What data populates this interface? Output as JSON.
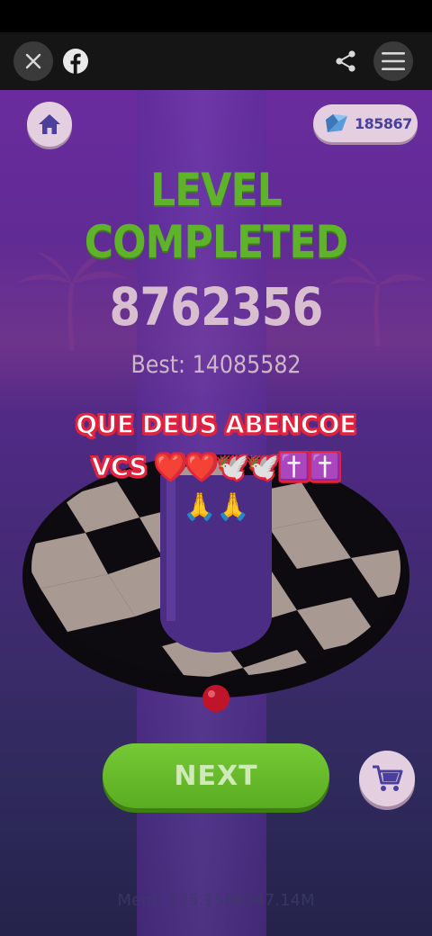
{
  "browser_bar": {
    "close_icon": "close-icon",
    "facebook_icon": "facebook-icon",
    "share_icon": "share-icon",
    "menu_icon": "menu-icon"
  },
  "hud": {
    "home_icon": "home-icon",
    "gem_icon": "gem-icon",
    "gem_count": "185867"
  },
  "result": {
    "title": "LEVEL COMPLETED",
    "score": "8762356",
    "best": "Best: 14085582"
  },
  "caption": {
    "line1": "QUE DEUS ABENCOE",
    "line2": "VCS ❤️❤️🕊️🕊️✝️✝️",
    "line3": "🙏🙏"
  },
  "actions": {
    "next_label": "NEXT",
    "cart_icon": "cart-icon"
  },
  "debug": {
    "memory": "Mem: 325.15M/347.14M"
  },
  "colors": {
    "title_green": "#5fb32a",
    "button_green": "#6bbd2c",
    "pill_bg": "#e3cfe0",
    "icon_purple": "#4a3f9c",
    "caption_red": "#e2233e"
  }
}
